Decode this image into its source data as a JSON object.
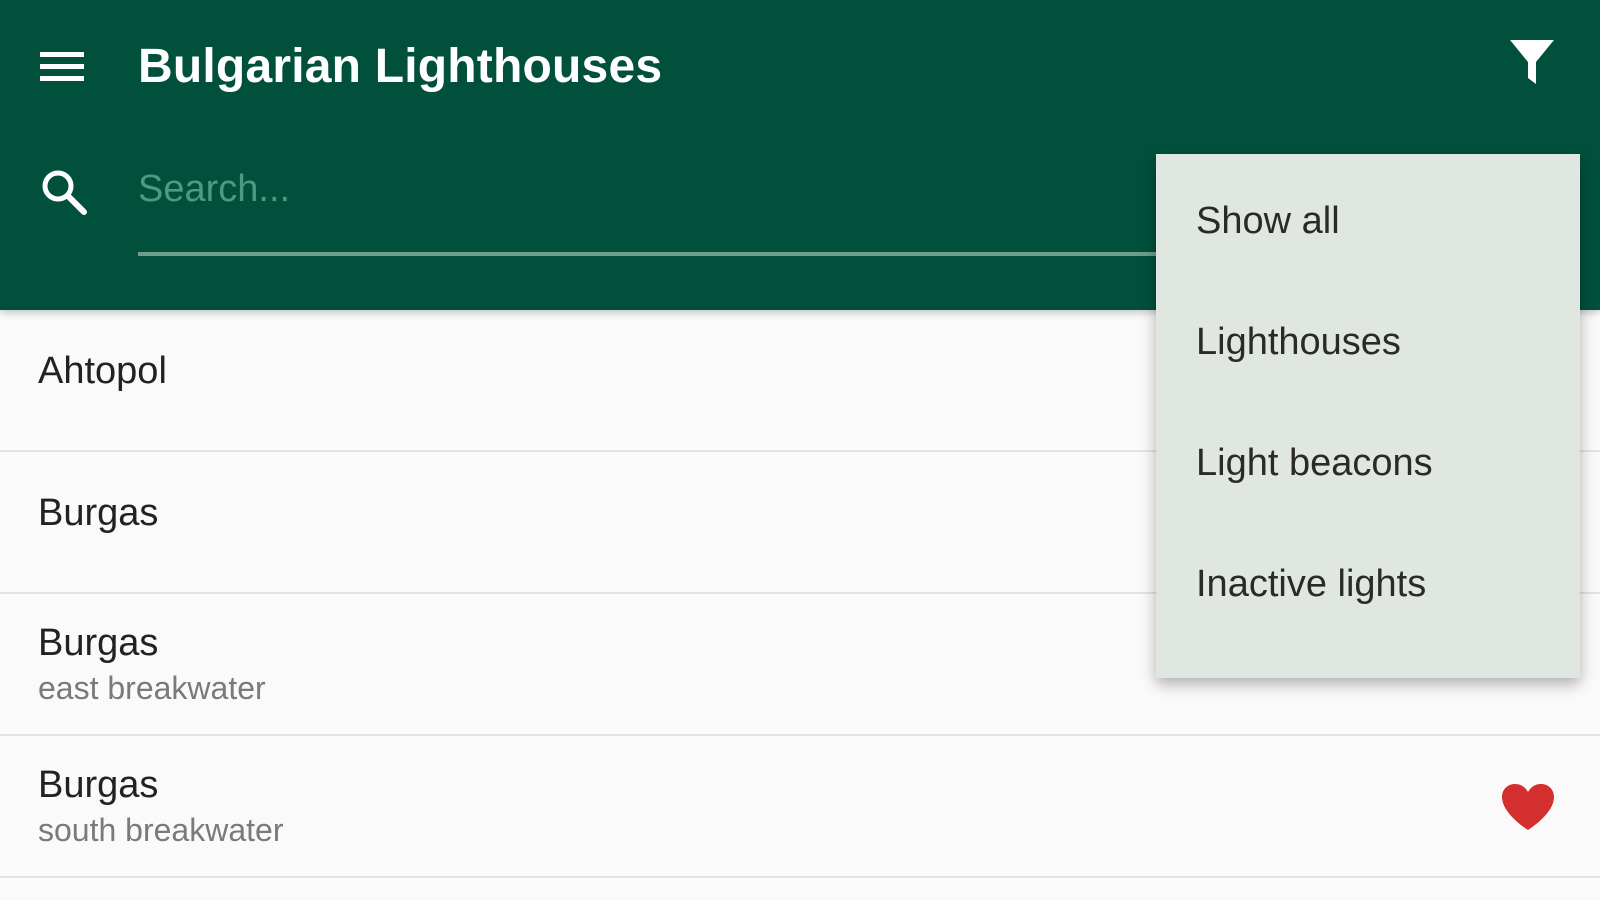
{
  "app": {
    "title": "Bulgarian Lighthouses"
  },
  "icons": {
    "menu": "menu-icon",
    "filter": "filter-icon",
    "search": "search-icon",
    "favorite": "heart-icon"
  },
  "colors": {
    "primary": "#00503c",
    "dropdown_bg": "#e0e7e1",
    "favorite": "#d32f2f",
    "list_bg": "#fafafa"
  },
  "search": {
    "placeholder": "Search...",
    "value": ""
  },
  "filter_menu": {
    "items": [
      {
        "label": "Show all"
      },
      {
        "label": "Lighthouses"
      },
      {
        "label": "Light beacons"
      },
      {
        "label": "Inactive lights"
      }
    ]
  },
  "list": {
    "items": [
      {
        "title": "Ahtopol",
        "subtitle": "",
        "favorite": false
      },
      {
        "title": "Burgas",
        "subtitle": "",
        "favorite": false
      },
      {
        "title": "Burgas",
        "subtitle": "east breakwater",
        "favorite": false
      },
      {
        "title": "Burgas",
        "subtitle": "south breakwater",
        "favorite": true
      }
    ]
  }
}
